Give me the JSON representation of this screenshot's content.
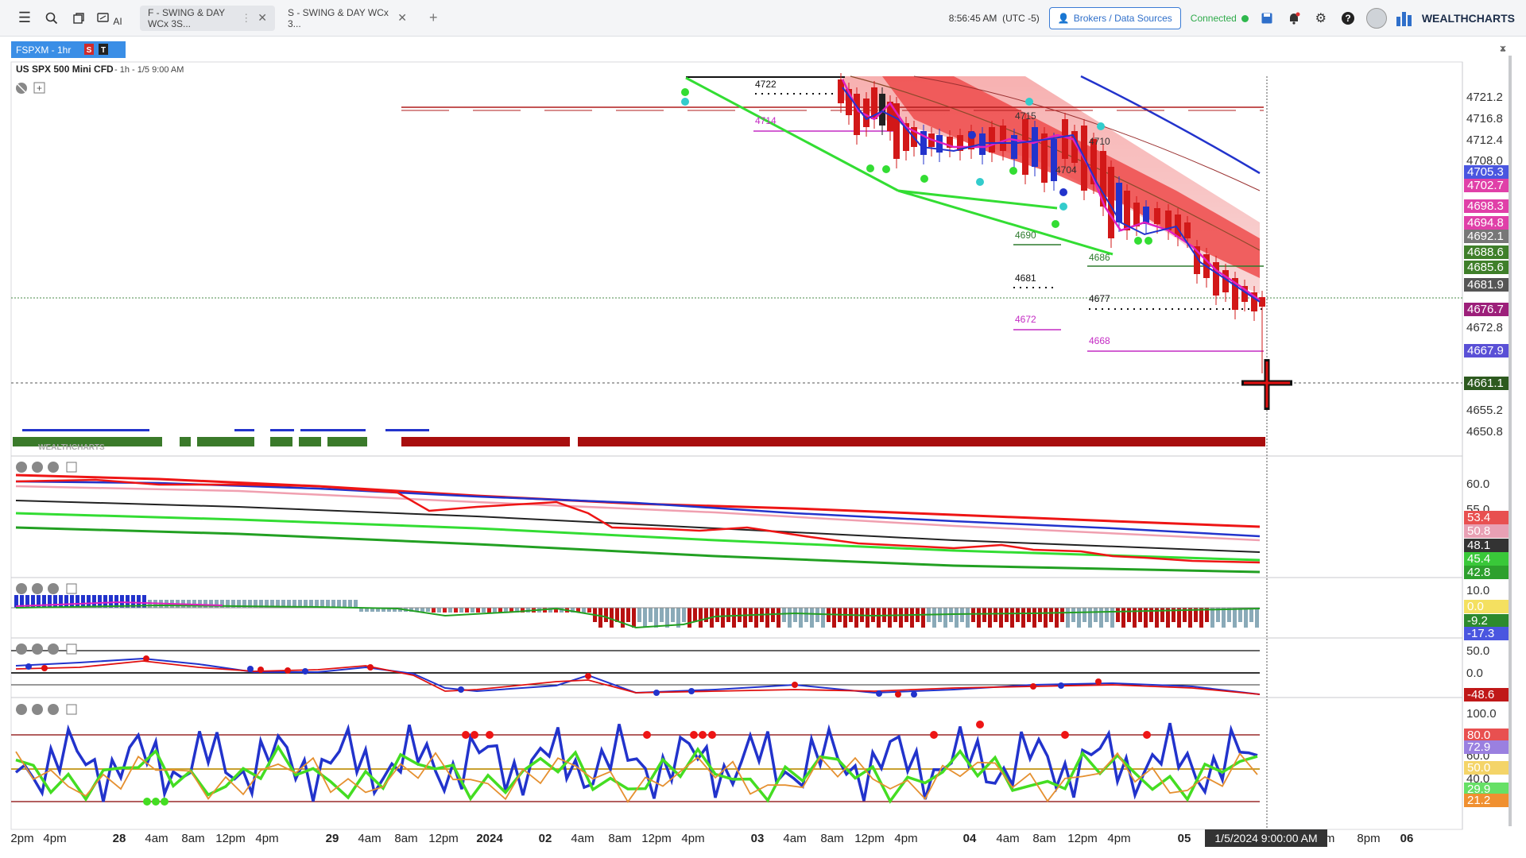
{
  "toolbar": {
    "tab_active": "F - SWING & DAY WCx 3S...",
    "tab_second": "S - SWING & DAY WCx 3...",
    "clock": "8:56:45 AM",
    "timezone": "(UTC -5)",
    "brokers_label": "Brokers / Data Sources",
    "connected_label": "Connected",
    "brand": "WEALTHCHARTS",
    "ai_label": "AI",
    "close_glyph": "✕",
    "dots_glyph": "⋮",
    "plus_glyph": "+"
  },
  "symbol": {
    "ticker": "FSPXM - 1hr",
    "badge_s": "S",
    "badge_t": "T",
    "name": "US SPX 500 Mini CFD",
    "info": "- 1h - 1/5 9:00 AM"
  },
  "watermark": "WEALTHCHARTS",
  "crosshair_time": "1/5/2024 9:00:00 AM",
  "time_labels": [
    {
      "t": "2pm",
      "bold": false
    },
    {
      "t": "4pm",
      "bold": false
    },
    {
      "t": "28",
      "bold": true
    },
    {
      "t": "4am",
      "bold": false
    },
    {
      "t": "8am",
      "bold": false
    },
    {
      "t": "12pm",
      "bold": false
    },
    {
      "t": "4pm",
      "bold": false
    },
    {
      "t": "29",
      "bold": true
    },
    {
      "t": "4am",
      "bold": false
    },
    {
      "t": "8am",
      "bold": false
    },
    {
      "t": "12pm",
      "bold": false
    },
    {
      "t": "2024",
      "bold": true
    },
    {
      "t": "02",
      "bold": true
    },
    {
      "t": "4am",
      "bold": false
    },
    {
      "t": "8am",
      "bold": false
    },
    {
      "t": "12pm",
      "bold": false
    },
    {
      "t": "4pm",
      "bold": false
    },
    {
      "t": "03",
      "bold": true
    },
    {
      "t": "4am",
      "bold": false
    },
    {
      "t": "8am",
      "bold": false
    },
    {
      "t": "12pm",
      "bold": false
    },
    {
      "t": "4pm",
      "bold": false
    },
    {
      "t": "04",
      "bold": true
    },
    {
      "t": "4am",
      "bold": false
    },
    {
      "t": "8am",
      "bold": false
    },
    {
      "t": "12pm",
      "bold": false
    },
    {
      "t": "4pm",
      "bold": false
    },
    {
      "t": "05",
      "bold": true
    },
    {
      "t": "pm",
      "bold": false
    },
    {
      "t": "8pm",
      "bold": false
    },
    {
      "t": "06",
      "bold": true
    }
  ],
  "price_axis": {
    "ticks": [
      "4721.2",
      "4716.8",
      "4712.4",
      "4708.0",
      "4672.8",
      "4655.2",
      "4650.8"
    ],
    "badges": [
      {
        "v": "4705.3",
        "color": "#4a56e0"
      },
      {
        "v": "4702.7",
        "color": "#e040a8"
      },
      {
        "v": "4698.3",
        "color": "#e040a8"
      },
      {
        "v": "4694.8",
        "color": "#e040a8"
      },
      {
        "v": "4692.1",
        "color": "#777777"
      },
      {
        "v": "4688.6",
        "color": "#3f7f2a"
      },
      {
        "v": "4685.6",
        "color": "#3f7f2a"
      },
      {
        "v": "4681.9",
        "color": "#555555"
      },
      {
        "v": "4676.7",
        "color": "#9c1f7a"
      },
      {
        "v": "4667.9",
        "color": "#5a50d6"
      },
      {
        "v": "4661.1",
        "color": "#2d5a1f"
      }
    ]
  },
  "level_labels": [
    {
      "t": "4722",
      "color": "#111111"
    },
    {
      "t": "4714",
      "color": "#c42cc4"
    },
    {
      "t": "4715",
      "color": "#333333"
    },
    {
      "t": "4710",
      "color": "#333333"
    },
    {
      "t": "4704",
      "color": "#333333"
    },
    {
      "t": "4690",
      "color": "#2d7a2d"
    },
    {
      "t": "4686",
      "color": "#2d7a2d"
    },
    {
      "t": "4681",
      "color": "#111111"
    },
    {
      "t": "4677",
      "color": "#111111"
    },
    {
      "t": "4672",
      "color": "#c42cc4"
    },
    {
      "t": "4668",
      "color": "#c42cc4"
    }
  ],
  "panel1_axis": {
    "ticks": [
      "60.0",
      "55.0"
    ],
    "badges": [
      {
        "v": "53.4",
        "color": "#e85050"
      },
      {
        "v": "50.8",
        "color": "#e8a0b4"
      },
      {
        "v": "48.1",
        "color": "#333333"
      },
      {
        "v": "45.4",
        "color": "#39c839"
      },
      {
        "v": "42.8",
        "color": "#2da02d"
      }
    ]
  },
  "panel2_axis": {
    "ticks": [
      "10.0"
    ],
    "badges": [
      {
        "v": "0.0",
        "color": "#f4e060"
      },
      {
        "v": "-9.2",
        "color": "#2d8a2d"
      },
      {
        "v": "-17.3",
        "color": "#4a56e0"
      }
    ]
  },
  "panel3_axis": {
    "ticks": [
      "50.0",
      "0.0"
    ],
    "badges": [
      {
        "v": "-48.6",
        "color": "#c01818"
      }
    ]
  },
  "panel4_axis": {
    "ticks": [
      "100.0",
      "60.0",
      "40.0"
    ],
    "badges": [
      {
        "v": "80.0",
        "color": "#e85050"
      },
      {
        "v": "72.9",
        "color": "#9a80e0"
      },
      {
        "v": "50.0",
        "color": "#f4d468"
      },
      {
        "v": "29.9",
        "color": "#66e066"
      },
      {
        "v": "21.2",
        "color": "#f09030"
      }
    ]
  }
}
